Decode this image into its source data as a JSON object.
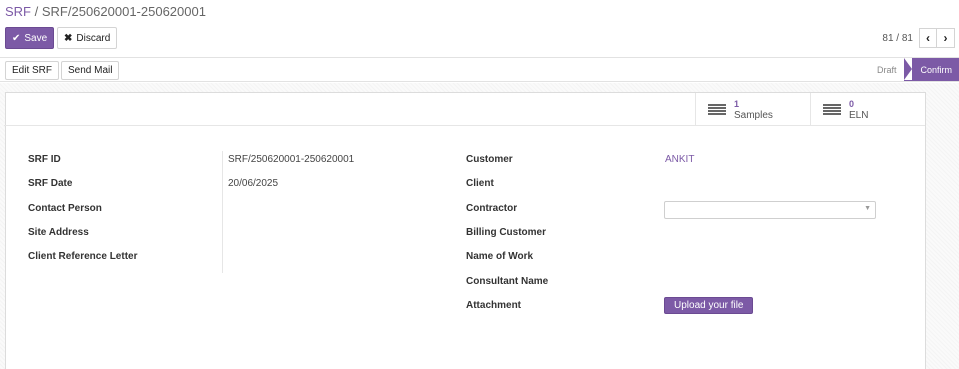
{
  "breadcrumb": {
    "parent": "SRF",
    "separator": "/",
    "current": "SRF/250620001-250620001"
  },
  "controls": {
    "save_label": "Save",
    "discard_label": "Discard"
  },
  "pager": {
    "value": "81 / 81"
  },
  "statusbar": {
    "buttons": [
      "Edit SRF",
      "Send Mail"
    ],
    "stages": [
      {
        "label": "Draft"
      },
      {
        "label": "Confirm"
      }
    ]
  },
  "smart_buttons": [
    {
      "count": "1",
      "label": "Samples"
    },
    {
      "count": "0",
      "label": "ELN"
    }
  ],
  "form": {
    "left": [
      {
        "label": "SRF ID",
        "value": "SRF/250620001-250620001"
      },
      {
        "label": "SRF Date",
        "value": "20/06/2025"
      },
      {
        "label": "Contact Person",
        "value": ""
      },
      {
        "label": "Site Address",
        "value": ""
      },
      {
        "label": "Client Reference Letter",
        "value": ""
      }
    ],
    "right": [
      {
        "label": "Customer",
        "value": "ANKIT"
      },
      {
        "label": "Client",
        "value": ""
      },
      {
        "label": "Contractor",
        "value": ""
      },
      {
        "label": "Billing Customer",
        "value": ""
      },
      {
        "label": "Name of Work",
        "value": ""
      },
      {
        "label": "Consultant Name",
        "value": ""
      },
      {
        "label": "Attachment",
        "value": ""
      }
    ],
    "upload_label": "Upload your file"
  },
  "colors": {
    "brand": "#7c5aa6"
  }
}
